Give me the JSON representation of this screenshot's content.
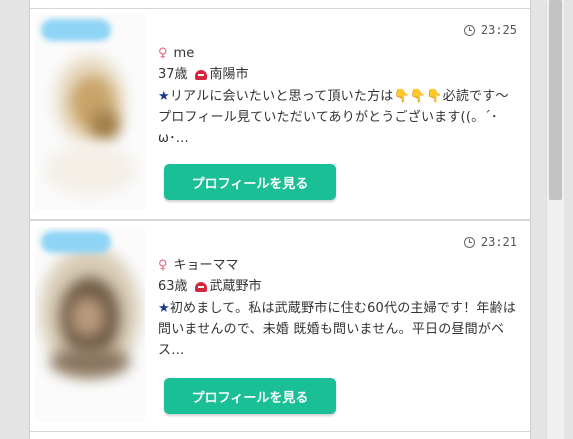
{
  "cards": [
    {
      "time": "23:25",
      "name": "me",
      "age": "37歳",
      "location": "南陽市",
      "message": "リアルに会いたいと思って頂いた方は👇👇👇必読です〜プロフィール見ていただいてありがとうございます((。´･ω･…",
      "button_label": "プロフィールを見る"
    },
    {
      "time": "23:21",
      "name": "キョーママ",
      "age": "63歳",
      "location": "武蔵野市",
      "message": "初めまして。私は武蔵野市に住む60代の主婦です！年齢は問いませんので、未婚 既婚も問いません。平日の昼間がベス…",
      "button_label": "プロフィールを見る"
    }
  ],
  "icons": {
    "gender": "female-icon",
    "time": "clock-icon",
    "location": "location-pin-icon",
    "message_mark": "star-icon"
  },
  "colors": {
    "button": "#1bbf95",
    "gender_icon": "#e8657f",
    "location_icon": "#d6263d",
    "star": "#1b3a8c"
  }
}
